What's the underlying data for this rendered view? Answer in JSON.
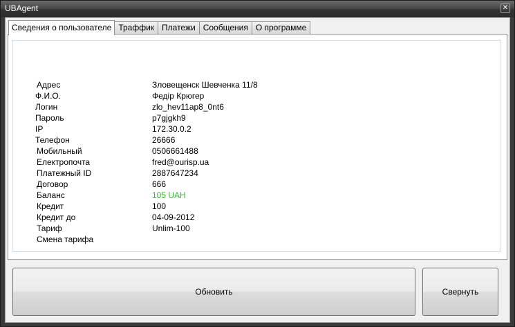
{
  "window": {
    "title": "UBAgent",
    "close_glyph": "✕"
  },
  "tabs": [
    {
      "label": "Сведения о пользователе",
      "active": true
    },
    {
      "label": "Траффик",
      "active": false
    },
    {
      "label": "Платежи",
      "active": false
    },
    {
      "label": "Сообщения",
      "active": false
    },
    {
      "label": "О программе",
      "active": false
    }
  ],
  "user_info": [
    {
      "label": "Адрес",
      "value": "Зловещенск Шевченка 11/8"
    },
    {
      "label": "Ф.И.О.",
      "value": "Федір Крюгер"
    },
    {
      "label": "Логин",
      "value": "zlo_hev11ap8_0nt6"
    },
    {
      "label": "Пароль",
      "value": "p7gjgkh9"
    },
    {
      "label": "IP",
      "value": "172.30.0.2"
    },
    {
      "label": "Телефон",
      "value": "26666"
    },
    {
      "label": "Мобильный",
      "value": "0506661488"
    },
    {
      "label": "Електропочта",
      "value": "fred@ourisp.ua"
    },
    {
      "label": "Платежный ID",
      "value": "2887647234"
    },
    {
      "label": "Договор",
      "value": "666"
    },
    {
      "label": "Баланс",
      "value": "105 UAH",
      "color": "#36b936"
    },
    {
      "label": "Кредит",
      "value": "100"
    },
    {
      "label": "Кредит до",
      "value": "04-09-2012"
    },
    {
      "label": "Тариф",
      "value": "Unlim-100"
    },
    {
      "label": "Смена тарифа",
      "value": ""
    }
  ],
  "buttons": {
    "refresh": "Обновить",
    "minimize": "Свернуть"
  }
}
